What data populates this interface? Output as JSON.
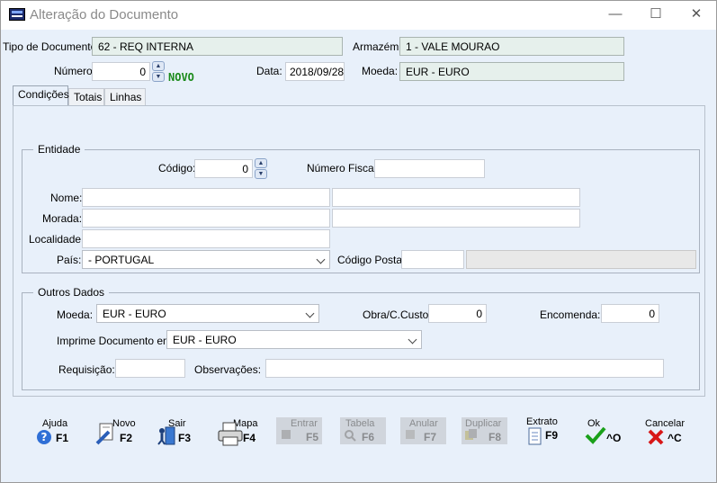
{
  "window": {
    "title": "Alteração do Documento",
    "min": "—",
    "max": "☐",
    "close": "✕"
  },
  "header": {
    "tipo_label": "Tipo de Documento:",
    "tipo_value": "62 - REQ INTERNA",
    "armazem_label": "Armazém:",
    "armazem_value": "1 - VALE MOURAO",
    "numero_label": "Número:",
    "numero_value": "0",
    "novo": "NOVO",
    "data_label": "Data:",
    "data_value": "2018/09/28",
    "moeda_label": "Moeda:",
    "moeda_value": "EUR - EURO"
  },
  "tabs": [
    {
      "label": "Condições"
    },
    {
      "label": "Totais"
    },
    {
      "label": "Linhas"
    }
  ],
  "entidade": {
    "title": "Entidade",
    "codigo_label": "Código:",
    "codigo_value": "0",
    "nif_label": "Número Fiscal:",
    "nif_value": "",
    "nome_label": "Nome:",
    "morada_label": "Morada:",
    "localidade_label": "Localidade:",
    "pais_label": "País:",
    "pais_value": "- PORTUGAL",
    "cp_label": "Código Postal:"
  },
  "outros": {
    "title": "Outros Dados",
    "moeda_label": "Moeda:",
    "moeda_value": "EUR - EURO",
    "obra_label": "Obra/C.Custo",
    "obra_value": "0",
    "encomenda_label": "Encomenda:",
    "encomenda_value": "0",
    "imprime_label": "Imprime Documento em:",
    "imprime_value": "EUR - EURO",
    "requisicao_label": "Requisição:",
    "observacoes_label": "Observações:"
  },
  "fkeys": [
    {
      "label": "Ajuda",
      "key": "F1",
      "icon": "help-icon"
    },
    {
      "label": "Novo",
      "key": "F2",
      "icon": "new-document-icon"
    },
    {
      "label": "Sair",
      "key": "F3",
      "icon": "exit-icon"
    },
    {
      "label": "Mapa",
      "key": "F4",
      "icon": "printer-icon"
    },
    {
      "label": "Entrar",
      "key": "F5",
      "icon": "enter-icon"
    },
    {
      "label": "Tabela",
      "key": "F6",
      "icon": "table-search-icon"
    },
    {
      "label": "Anular",
      "key": "F7",
      "icon": "cancel-document-icon"
    },
    {
      "label": "Duplicar",
      "key": "F8",
      "icon": "duplicate-icon"
    },
    {
      "label": "Extrato",
      "key": "F9",
      "icon": "statement-icon"
    },
    {
      "label": "Ok",
      "key": "^O",
      "icon": "check-icon"
    },
    {
      "label": "Cancelar",
      "key": "^C",
      "icon": "cross-icon"
    }
  ]
}
